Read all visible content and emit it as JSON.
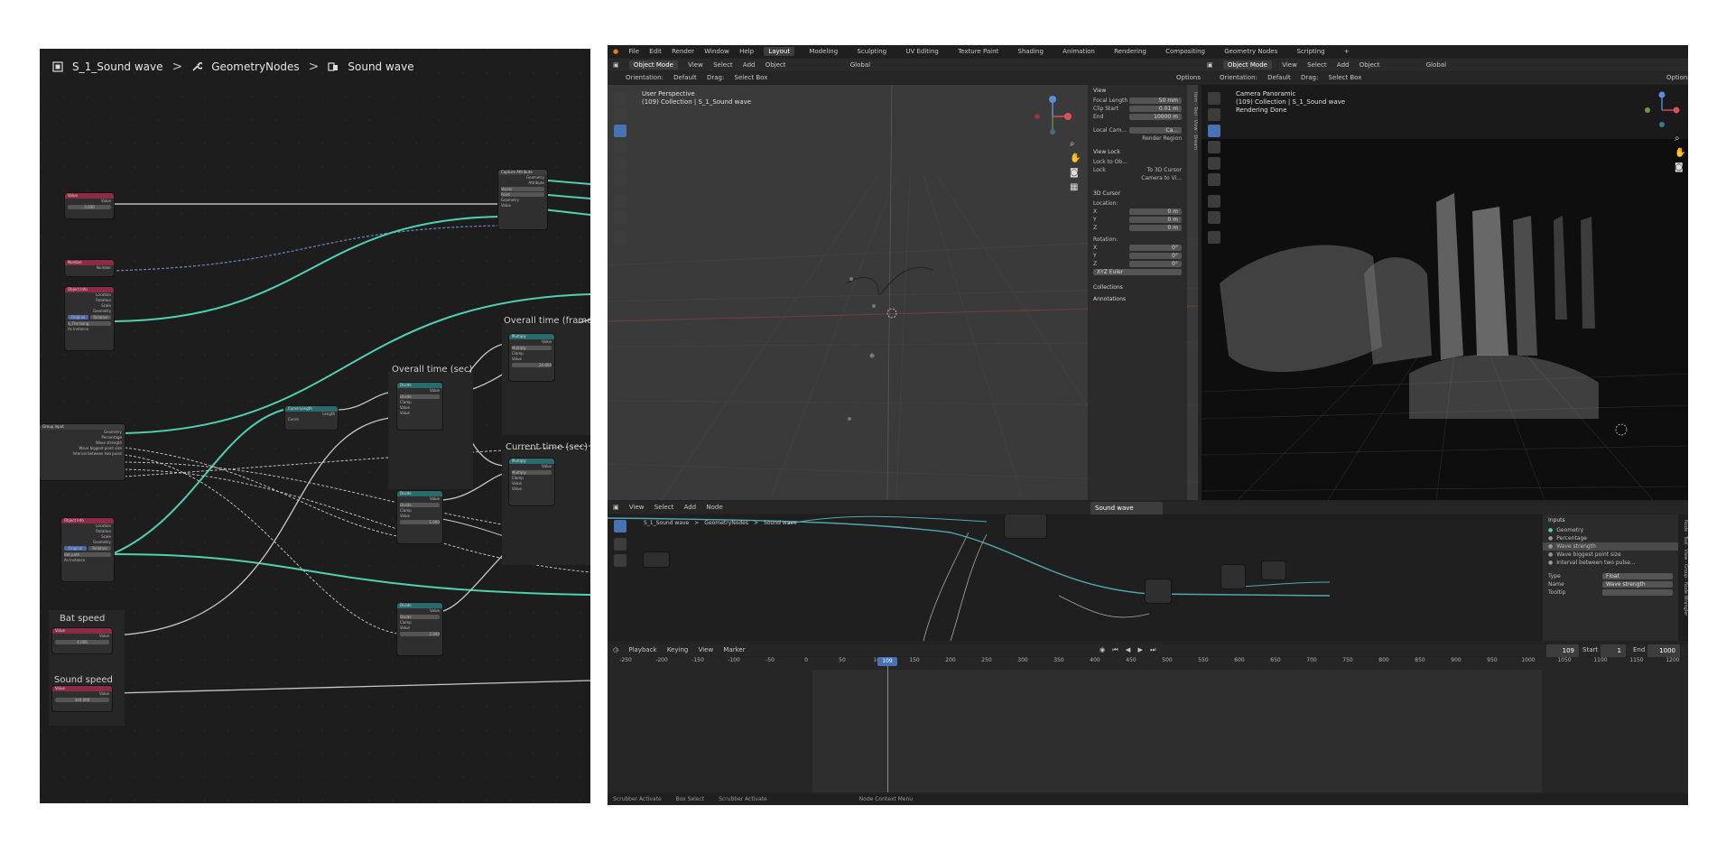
{
  "left_editor": {
    "breadcrumb": [
      {
        "label": "S_1_Sound wave",
        "icon": "object-icon"
      },
      {
        "label": "GeometryNodes",
        "icon": "wrench-icon"
      },
      {
        "label": "Sound wave",
        "icon": "node-tree-icon"
      }
    ],
    "frame_labels": {
      "overall_frame": "Overall time (frame)",
      "overall_sec": "Overall time (sec)",
      "current_sec": "Current time (sec)",
      "bat_speed": "Bat speed",
      "sound_speed": "Sound speed"
    },
    "nodes": {
      "value1_title": "Value",
      "value1_out": "Value",
      "value1_field": "3.000",
      "number_title": "Number",
      "number_out": "Number",
      "objinfo1_title": "Object Info",
      "objinfo_rows": [
        "Location",
        "Rotation",
        "Scale",
        "Geometry"
      ],
      "objinfo_btn1": "Original",
      "objinfo_btn2": "Relative",
      "objinfo1_obj": "S_The bang",
      "objinfo_check": "As Instance",
      "group_title": "Group Input",
      "group_rows": [
        "Geometry",
        "Percentage",
        "Wave strength",
        "Wave biggest point size",
        "Interval between two pulse"
      ],
      "objinfo2_title": "Object Info",
      "objinfo2_obj": "Bat path",
      "capture_title": "Capture Attribute",
      "capture_rows": [
        "Geometry",
        "Attribute",
        "Vector",
        "Point",
        "Geometry",
        "Value"
      ],
      "curve_title": "Curve Length",
      "curve_out": "Length",
      "curve_in": "Curve",
      "divide1_title": "Divide",
      "op_divide": "Divide",
      "op_multiply": "Multiply",
      "clamp": "Clamp",
      "value": "Value",
      "num_24": "24.000",
      "num_1": "1.000",
      "num_2": "2.000",
      "bat_field": "4.000",
      "sound_field": "340.000"
    }
  },
  "blender": {
    "menu": [
      "File",
      "Edit",
      "Render",
      "Window",
      "Help"
    ],
    "workspaces": [
      "Layout",
      "Modeling",
      "Sculpting",
      "UV Editing",
      "Texture Paint",
      "Shading",
      "Animation",
      "Rendering",
      "Compositing",
      "Geometry Nodes",
      "Scripting",
      "+"
    ],
    "active_workspace": "Layout",
    "header_left": {
      "mode": "Object Mode",
      "items": [
        "View",
        "Select",
        "Add",
        "Object"
      ],
      "transform": "Global"
    },
    "header_right": {
      "mode": "Object Mode",
      "items": [
        "View",
        "Select",
        "Add",
        "Object"
      ],
      "transform": "Global"
    },
    "tool_header": {
      "orientation_label": "Orientation:",
      "orientation": "Default",
      "drag_label": "Drag:",
      "drag": "Select Box",
      "options": "Options"
    },
    "viewport_left": {
      "title": "User Perspective",
      "subtitle": "(109) Collection | S_1_Sound wave"
    },
    "viewport_right": {
      "title": "Camera Panoramic",
      "subtitle": "(109) Collection | S_1_Sound wave",
      "status": "Rendering Done"
    },
    "npanel": {
      "view_header": "View",
      "focal_label": "Focal Length",
      "focal": "50 mm",
      "clip_start_label": "Clip Start",
      "clip_start": "0.01 m",
      "end_label": "End",
      "end": "10000 m",
      "local_cam_label": "Local Cam...",
      "local_cam": "Ca...",
      "render_region": "Render Region",
      "view_lock": "View Lock",
      "lock_obj_label": "Lock to Ob...",
      "lock_label": "Lock",
      "to_cursor": "To 3D Cursor",
      "cam_to_view": "Camera to Vi...",
      "cursor_header": "3D Cursor",
      "location_label": "Location:",
      "x": "X",
      "y": "Y",
      "z": "Z",
      "loc_x": "0 m",
      "loc_y": "0 m",
      "loc_z": "0 m",
      "rotation_label": "Rotation:",
      "rot_x": "0°",
      "rot_y": "0°",
      "rot_z": "0°",
      "euler": "XYZ Euler",
      "collections": "Collections",
      "annotations": "Annotations",
      "tabs": [
        "Item",
        "Tool",
        "View",
        "Dream"
      ]
    },
    "node_editor": {
      "menu": [
        "View",
        "Select",
        "Add",
        "Node"
      ],
      "tree_name": "Sound wave",
      "breadcrumb": [
        "S_1_Sound wave",
        "GeometryNodes",
        "Sound wave"
      ],
      "inputs_header": "Inputs",
      "inputs": [
        "Geometry",
        "Percentage",
        "Wave strength",
        "Wave biggest point size",
        "Interval between two pulse..."
      ],
      "active_input": "Wave strength",
      "type_label": "Type",
      "type": "Float",
      "name_label": "Name",
      "name": "Wave strength",
      "tooltip_label": "Tooltip",
      "side_tabs": [
        "Node",
        "Tool",
        "View",
        "Group",
        "Node Wrangler"
      ]
    },
    "timeline": {
      "menu": [
        "Playback",
        "Keying",
        "View",
        "Marker"
      ],
      "current_frame": "109",
      "frame_field": "109",
      "start_label": "Start",
      "start": "1",
      "end_label": "End",
      "end": "1000",
      "ticks": [
        "-250",
        "-200",
        "-150",
        "-100",
        "-50",
        "0",
        "50",
        "100",
        "150",
        "200",
        "250",
        "300",
        "350",
        "400",
        "450",
        "500",
        "550",
        "600",
        "650",
        "700",
        "750",
        "800",
        "850",
        "900",
        "950",
        "1000",
        "1050",
        "1100",
        "1150",
        "1200"
      ]
    },
    "statusbar": [
      "Scrubber Activate",
      "Box Select",
      "Scrubber Activate",
      "Node Context Menu"
    ],
    "colors": {
      "accent": "#4772b3",
      "teal_wire": "#4fd0b0",
      "playhead": "#4aa3c7",
      "node_red": "#8a2d44",
      "node_teal": "#2b6a6c"
    }
  }
}
